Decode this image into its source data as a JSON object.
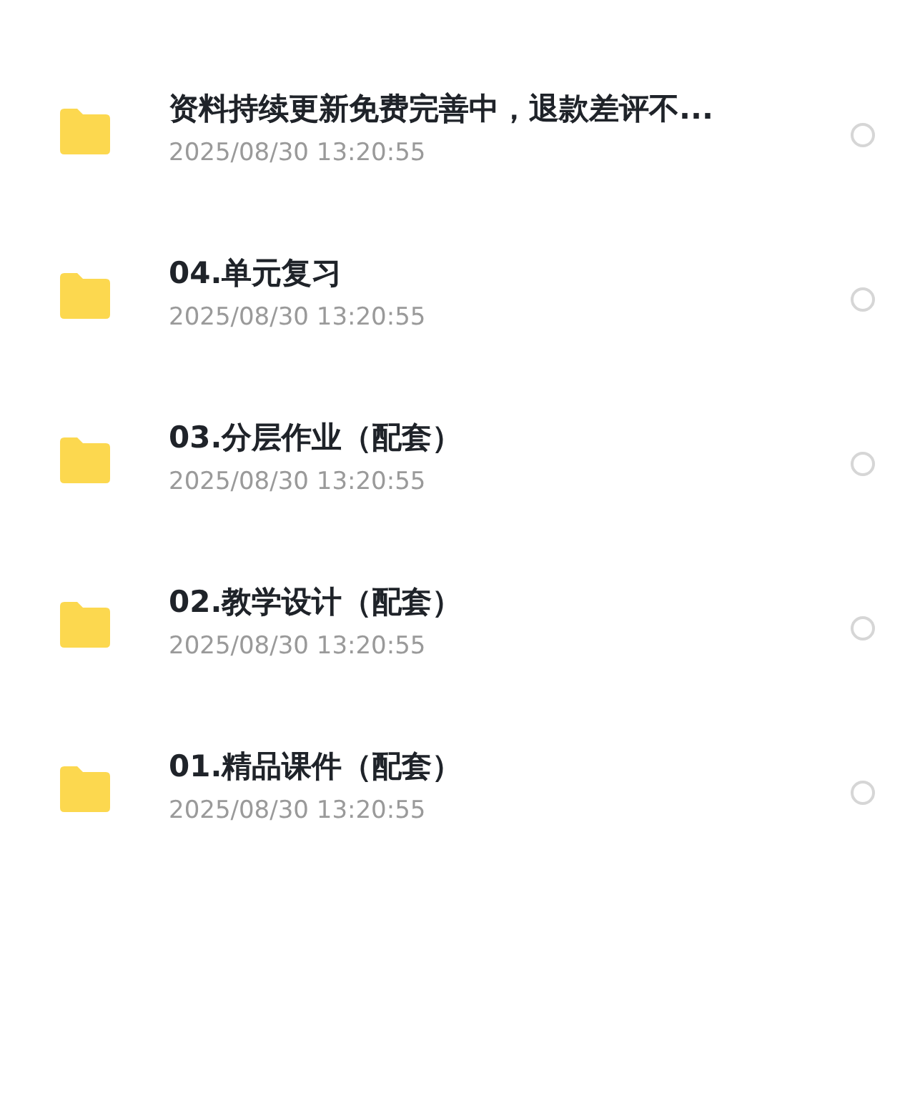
{
  "files": [
    {
      "name": "资料持续更新免费完善中，退款差评不...",
      "date": "2025/08/30 13:20:55",
      "selected": false
    },
    {
      "name": "04.单元复习",
      "date": "2025/08/30 13:20:55",
      "selected": false
    },
    {
      "name": "03.分层作业（配套）",
      "date": "2025/08/30 13:20:55",
      "selected": false
    },
    {
      "name": "02.教学设计（配套）",
      "date": "2025/08/30 13:20:55",
      "selected": false
    },
    {
      "name": "01.精品课件（配套）",
      "date": "2025/08/30 13:20:55",
      "selected": false
    }
  ]
}
